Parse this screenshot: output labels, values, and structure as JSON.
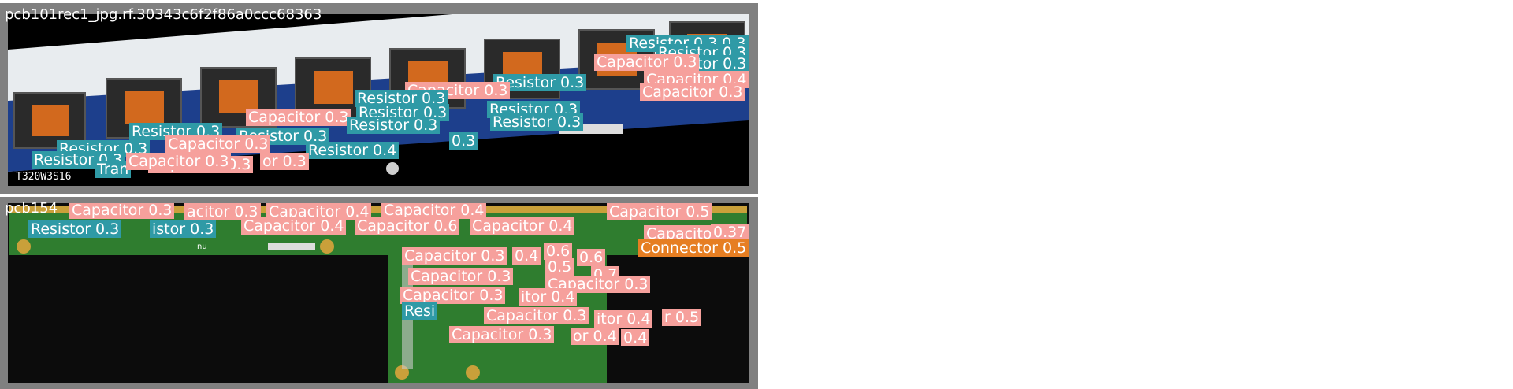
{
  "panels": [
    {
      "title": "pcb101rec1_jpg.rf.30343c6f2f86a0ccc68363",
      "detections": [
        {
          "cls": "resistor",
          "text": "Resistor 0.3 0.3"
        },
        {
          "cls": "resistor",
          "text": "Resistor 0.3"
        },
        {
          "cls": "resistor",
          "text": "istor 0.3"
        },
        {
          "cls": "capacitor",
          "text": "Capacitor 0.3"
        },
        {
          "cls": "capacitor",
          "text": "Capacitor 0.4"
        },
        {
          "cls": "resistor",
          "text": "Resistor 0.3"
        },
        {
          "cls": "capacitor",
          "text": "Capacitor 0.3"
        },
        {
          "cls": "capacitor",
          "text": "Capacitor 0.3"
        },
        {
          "cls": "resistor",
          "text": "Resistor 0.3"
        },
        {
          "cls": "resistor",
          "text": "Resistor 0.3"
        },
        {
          "cls": "resistor",
          "text": "Resistor 0.3"
        },
        {
          "cls": "capacitor",
          "text": "Capacitor 0.3"
        },
        {
          "cls": "resistor",
          "text": "Resistor 0.3"
        },
        {
          "cls": "resistor",
          "text": "Resistor 0.3"
        },
        {
          "cls": "resistor",
          "text": "Resistor 0.3"
        },
        {
          "cls": "resistor",
          "text": "Resistor 0.3"
        },
        {
          "cls": "resistor",
          "text": "Resistor 0.4"
        },
        {
          "cls": "resistor",
          "text": "0.3"
        },
        {
          "cls": "resistor",
          "text": "Resistor 0.3"
        },
        {
          "cls": "capacitor",
          "text": "Capacitor 0.3"
        },
        {
          "cls": "capacitor",
          "text": "Capacitor 0.3"
        },
        {
          "cls": "resistor",
          "text": "Resistor 0.3"
        },
        {
          "cls": "transistor",
          "text": "Tran"
        },
        {
          "cls": "capacitor",
          "text": "Capacitor 0.3"
        },
        {
          "cls": "capacitor",
          "text": "or 0.3"
        }
      ]
    },
    {
      "title": "pcb154",
      "detections": [
        {
          "cls": "capacitor",
          "text": "Capacitor 0.3"
        },
        {
          "cls": "capacitor",
          "text": "acitor 0.3"
        },
        {
          "cls": "capacitor",
          "text": "Capacitor 0.4"
        },
        {
          "cls": "capacitor",
          "text": "Capacitor 0.4"
        },
        {
          "cls": "capacitor",
          "text": "Capacitor 0.5"
        },
        {
          "cls": "resistor",
          "text": "Resistor 0.3"
        },
        {
          "cls": "resistor",
          "text": "istor 0.3"
        },
        {
          "cls": "capacitor",
          "text": "Capacitor 0.4"
        },
        {
          "cls": "capacitor",
          "text": "Capacitor 0.6"
        },
        {
          "cls": "capacitor",
          "text": "Capacitor 0.4"
        },
        {
          "cls": "capacitor",
          "text": "Capacitor 0.3"
        },
        {
          "cls": "capacitor",
          "text": "0.37"
        },
        {
          "cls": "connector",
          "text": "Connector 0.5"
        },
        {
          "cls": "capacitor",
          "text": "Capacitor 0.3"
        },
        {
          "cls": "capacitor",
          "text": "0.4"
        },
        {
          "cls": "capacitor",
          "text": "0.6"
        },
        {
          "cls": "capacitor",
          "text": "0.5"
        },
        {
          "cls": "capacitor",
          "text": "0.6"
        },
        {
          "cls": "capacitor",
          "text": "Capacitor 0.3"
        },
        {
          "cls": "capacitor",
          "text": "0.7"
        },
        {
          "cls": "capacitor",
          "text": "Capacitor 0.3"
        },
        {
          "cls": "capacitor",
          "text": "Capacitor 0.3"
        },
        {
          "cls": "capacitor",
          "text": "itor 0.4"
        },
        {
          "cls": "resistor",
          "text": "Resi"
        },
        {
          "cls": "capacitor",
          "text": "Capacitor 0.3"
        },
        {
          "cls": "capacitor",
          "text": "itor 0.4"
        },
        {
          "cls": "capacitor",
          "text": "r 0.5"
        },
        {
          "cls": "capacitor",
          "text": "Capacitor 0.3"
        },
        {
          "cls": "capacitor",
          "text": "or 0.4"
        },
        {
          "cls": "capacitor",
          "text": "0.4"
        }
      ]
    }
  ],
  "colors": {
    "resistor": "#2f9aa6",
    "capacitor": "#f6a09c",
    "transistor": "#2f9aa6",
    "connector": "#e67e22"
  }
}
